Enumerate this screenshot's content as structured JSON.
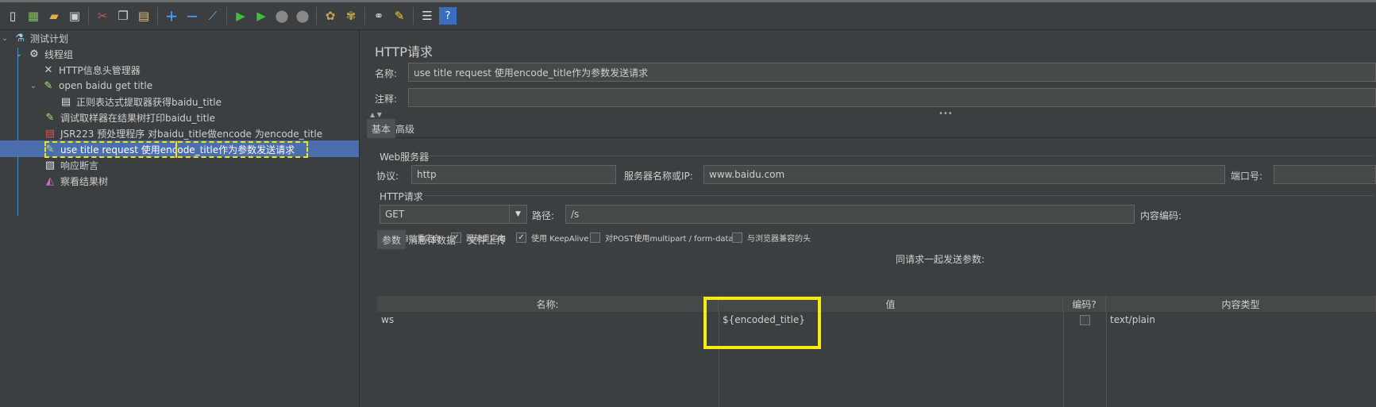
{
  "toolbar": {
    "buttons": [
      "new-icon",
      "templates-icon",
      "open-icon",
      "save-icon",
      "cut-icon",
      "copy-icon",
      "paste-icon",
      "expand-icon",
      "collapse-icon",
      "toggle-icon",
      "start-icon",
      "start-no-pause-icon",
      "stop-icon",
      "shutdown-icon",
      "clear-icon",
      "clear-all-icon",
      "search-icon",
      "reset-search-icon",
      "function-helper-icon",
      "help-icon"
    ]
  },
  "tree": {
    "items": [
      {
        "label": "测试计划"
      },
      {
        "label": "线程组"
      },
      {
        "label": "HTTP信息头管理器"
      },
      {
        "label": "open baidu get title"
      },
      {
        "label": "正则表达式提取器获得baidu_title"
      },
      {
        "label": "调试取样器在结果树打印baidu_title"
      },
      {
        "label": "JSR223 预处理程序  对baidu_title做encode 为encode_title"
      },
      {
        "label": "use title request  使用encode_title作为参数发送请求"
      },
      {
        "label": "响应断言"
      },
      {
        "label": "察看结果树"
      }
    ]
  },
  "panel": {
    "title": "HTTP请求",
    "name_label": "名称:",
    "name_value": "use title request  使用encode_title作为参数发送请求",
    "comment_label": "注释:",
    "comment_value": "",
    "tabs": [
      {
        "label": "基本"
      },
      {
        "label": "高级"
      }
    ],
    "web_server": {
      "title": "Web服务器",
      "protocol_label": "协议:",
      "protocol_value": "http",
      "server_label": "服务器名称或IP:",
      "server_value": "www.baidu.com",
      "port_label": "端口号:",
      "port_value": ""
    },
    "http_request": {
      "title": "HTTP请求",
      "method": "GET",
      "path_label": "路径:",
      "path_value": "/s",
      "encoding_label": "内容编码:"
    },
    "options": [
      {
        "label": "自动重定向",
        "checked": false
      },
      {
        "label": "跟随重定向",
        "checked": true
      },
      {
        "label": "使用 KeepAlive",
        "checked": true
      },
      {
        "label": "对POST使用multipart / form-data",
        "checked": false
      },
      {
        "label": "与浏览器兼容的头",
        "checked": false
      }
    ],
    "sub_tabs": [
      {
        "label": "参数"
      },
      {
        "label": "消息体数据"
      },
      {
        "label": "文件上传"
      }
    ],
    "params_caption": "同请求一起发送参数:",
    "table": {
      "headers": [
        "名称:",
        "值",
        "编码?",
        "内容类型"
      ],
      "rows": [
        {
          "name": "ws",
          "value": "${encoded_title}",
          "encode": false,
          "content_type": "text/plain"
        }
      ]
    }
  }
}
